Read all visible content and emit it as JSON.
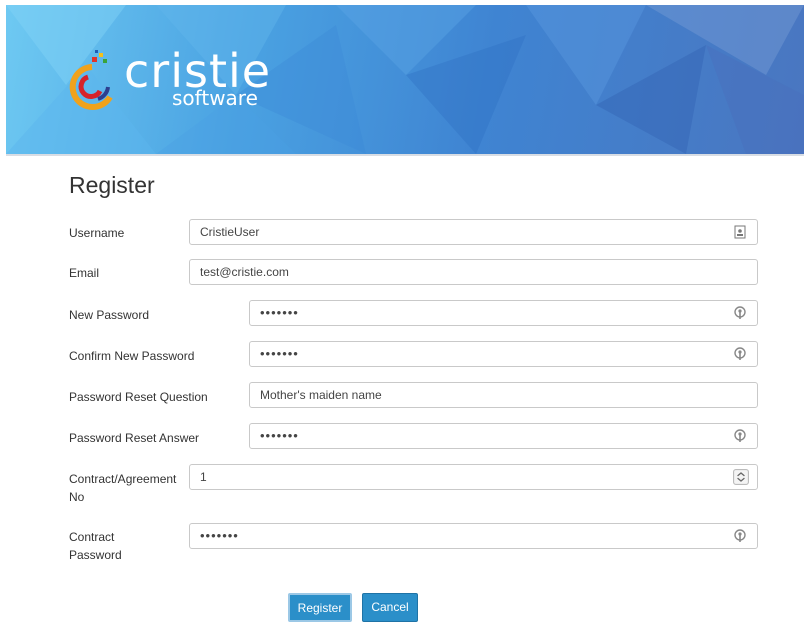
{
  "brand": {
    "name": "cristie",
    "sub": "software"
  },
  "page_title": "Register",
  "fields": {
    "username": {
      "label": "Username",
      "value": "CristieUser",
      "icon": "contact-card-icon"
    },
    "email": {
      "label": "Email",
      "value": "test@cristie.com"
    },
    "new_password": {
      "label": "New Password",
      "value": "•••••••",
      "icon": "key-icon"
    },
    "confirm_password": {
      "label": "Confirm New Password",
      "value": "•••••••",
      "icon": "key-icon"
    },
    "reset_question": {
      "label": "Password Reset Question",
      "value": "Mother's maiden name"
    },
    "reset_answer": {
      "label": "Password Reset Answer",
      "value": "•••••••",
      "icon": "key-icon"
    },
    "contract_no": {
      "label_line1": "Contract/Agreement",
      "label_line2": "No",
      "value": "1",
      "icon": "spinner-icon"
    },
    "contract_password": {
      "label_line1": "Contract",
      "label_line2": "Password",
      "value": "•••••••",
      "icon": "key-icon"
    }
  },
  "buttons": {
    "register": "Register",
    "cancel": "Cancel"
  },
  "colors": {
    "accent": "#2b8fc9",
    "banner": "#4a90dc"
  }
}
